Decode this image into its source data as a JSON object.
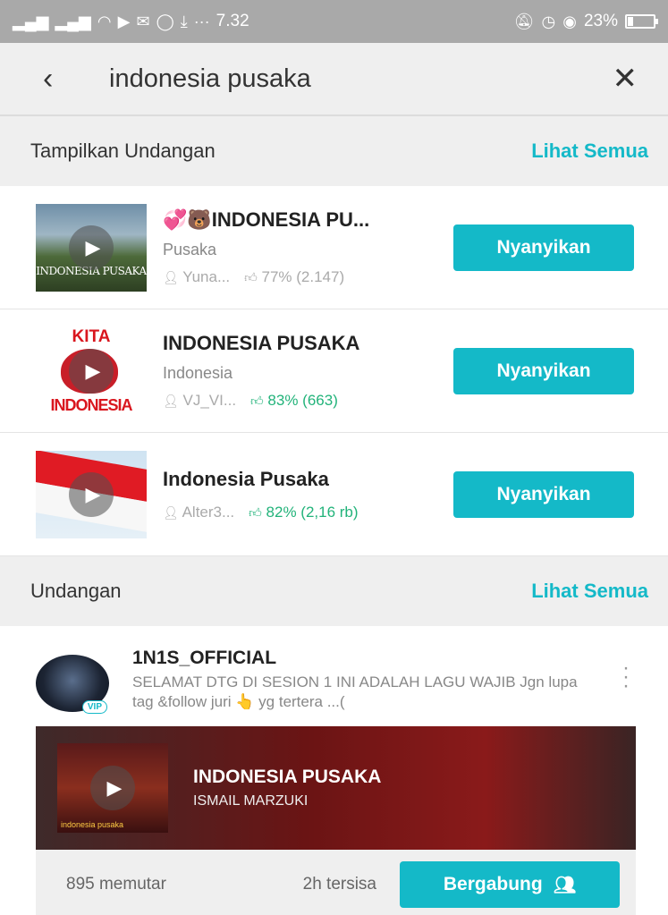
{
  "status_bar": {
    "time": "7.32",
    "battery": "23%",
    "battery_level": 0.23,
    "left_icons": [
      "signal-icon",
      "signal-icon",
      "wifi-icon",
      "media-icon",
      "mail-icon",
      "whatsapp-icon",
      "download-icon",
      "more-icon"
    ],
    "right_icons": [
      "mute-icon",
      "alarm-icon",
      "eye-icon"
    ]
  },
  "search": {
    "query": "indonesia pusaka",
    "back_icon": "back-arrow-icon",
    "clear_icon": "close-icon"
  },
  "featured": {
    "title": "Tampilkan Undangan",
    "see_all": "Lihat Semua",
    "sing_label": "Nyanyikan",
    "songs": [
      {
        "title": "💞🐻INDONESIA PU...",
        "artist": "Pusaka",
        "user": "Yuna...",
        "rating": "77% (2.147)",
        "thumb_caption": "INDONESIA PUSAKA"
      },
      {
        "title": "INDONESIA PUSAKA",
        "artist": "Indonesia",
        "user": "VJ_VI...",
        "rating": "83% (663)",
        "thumb_top": "KITA",
        "thumb_bottom": "INDONESIA"
      },
      {
        "title": "Indonesia Pusaka",
        "artist": "",
        "user": "Alter3...",
        "rating": "82% (2,16 rb)"
      }
    ]
  },
  "invitations": {
    "title": "Undangan",
    "see_all": "Lihat Semua",
    "card": {
      "user": "1N1S_OFFICIAL",
      "vip": "VIP",
      "description": "SELAMAT DTG DI SESION 1 INI ADALAH LAGU WAJIB Jgn lupa tag &follow juri 👆 yg tertera ...(",
      "song_title": "INDONESIA PUSAKA",
      "song_artist": "ISMAIL MARZUKI",
      "thumb_caption": "indonesia pusaka",
      "plays": "895 memutar",
      "time_left": "2h tersisa",
      "join_label": "Bergabung"
    }
  },
  "colors": {
    "accent": "#14b9c8",
    "rating_green": "#22b37a",
    "status_bar": "#a9a9a9"
  }
}
